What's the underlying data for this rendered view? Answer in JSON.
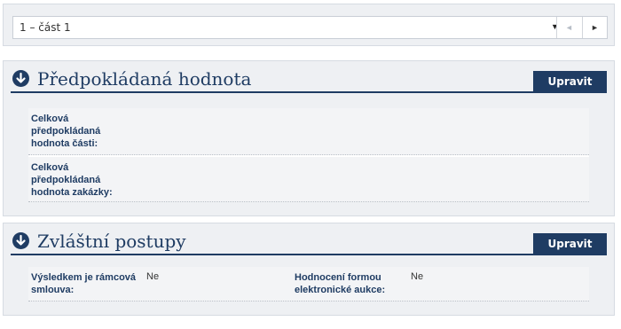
{
  "part_selector": {
    "selected": "1 – část 1",
    "dropdown_arrow": "▼",
    "prev": "◄",
    "next": "►"
  },
  "sections": [
    {
      "title": "Předpokládaná hodnota",
      "edit_label": "Upravit",
      "rows": [
        {
          "label": "Celková předpokládaná hodnota části:",
          "value": ""
        },
        {
          "label": "Celková předpokládaná hodnota zakázky:",
          "value": ""
        }
      ]
    },
    {
      "title": "Zvláštní postupy",
      "edit_label": "Upravit",
      "fields": [
        {
          "label": "Výsledkem je rámcová smlouva:",
          "value": "Ne"
        },
        {
          "label": "Hodnocení formou elektronické aukce:",
          "value": "Ne"
        }
      ]
    }
  ],
  "colors": {
    "accent": "#1f3c63",
    "panel": "#eef0f3",
    "row": "#f3f4f6"
  }
}
